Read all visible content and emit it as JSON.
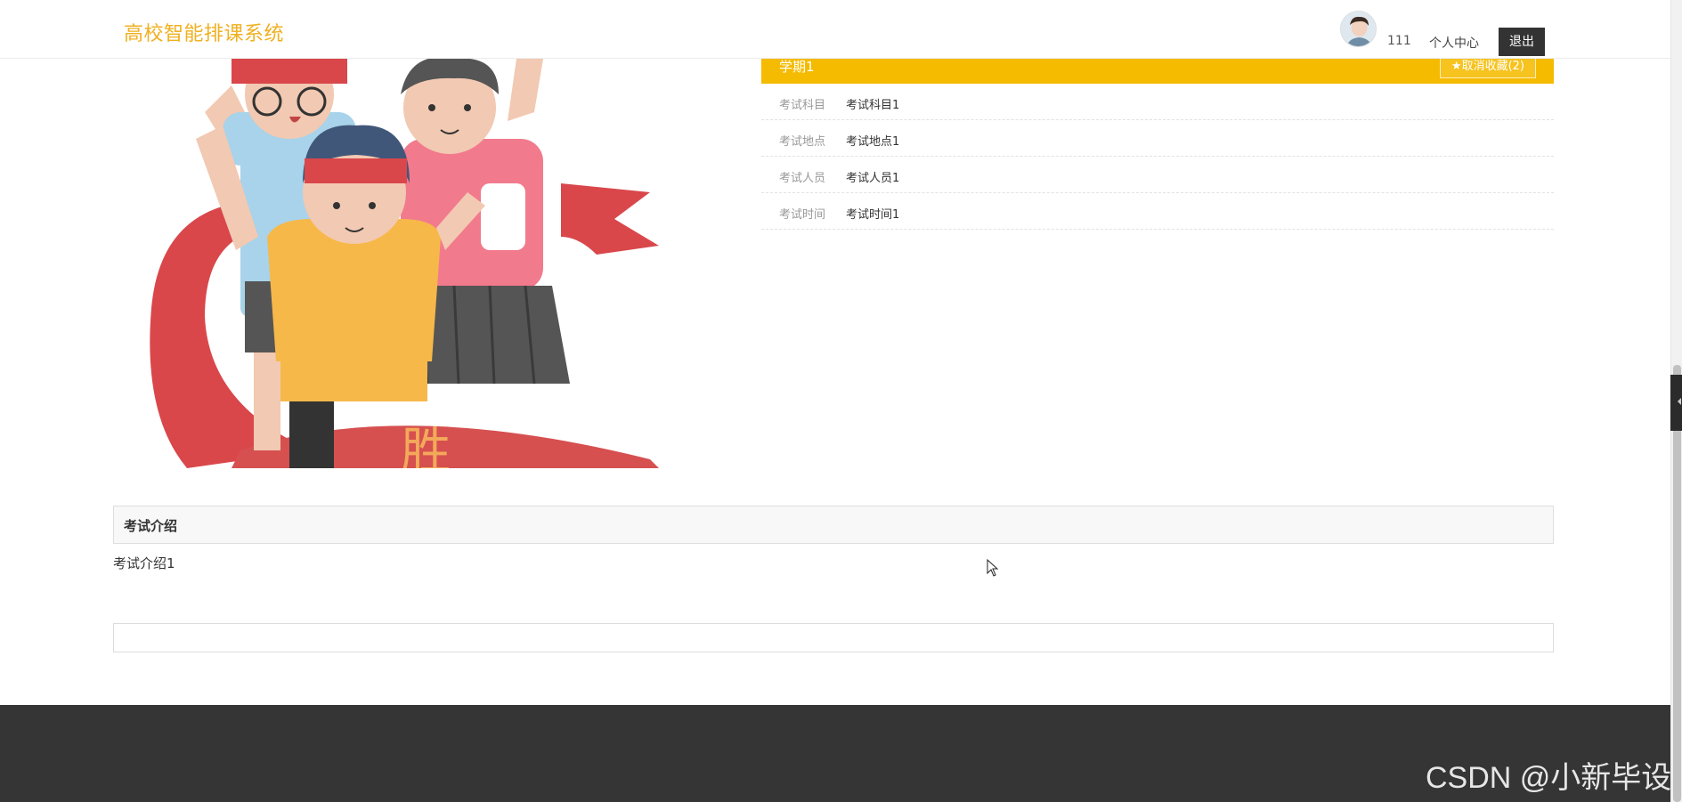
{
  "header": {
    "brand": "高校智能排课系统",
    "username": "111",
    "user_center_label": "个人中心",
    "logout_label": "退出"
  },
  "detail": {
    "title": "学期1",
    "favorite_label": "★取消收藏(2)",
    "fields": [
      {
        "label": "考试科目",
        "value": "考试科目1"
      },
      {
        "label": "考试地点",
        "value": "考试地点1"
      },
      {
        "label": "考试人员",
        "value": "考试人员1"
      },
      {
        "label": "考试时间",
        "value": "考试时间1"
      }
    ]
  },
  "intro": {
    "heading": "考试介绍",
    "body": "考试介绍1"
  },
  "watermark": "CSDN @小新毕设",
  "icons": {
    "avatar": "user-avatar",
    "cursor": "mouse-pointer-icon"
  },
  "colors": {
    "brand": "#f0b020",
    "accent_bar": "#f5bb00",
    "footer": "#353535",
    "logout_button": "#333333"
  }
}
